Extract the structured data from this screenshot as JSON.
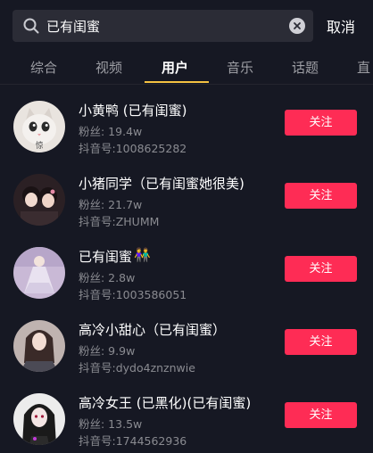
{
  "search": {
    "value": "已有闺蜜",
    "cancel_label": "取消"
  },
  "tabs": [
    {
      "label": "综合"
    },
    {
      "label": "视频"
    },
    {
      "label": "用户"
    },
    {
      "label": "音乐"
    },
    {
      "label": "话题"
    },
    {
      "label": "直"
    }
  ],
  "active_tab": "用户",
  "accent_colors": {
    "follow": "#fe2c55",
    "tab_underline": "#f5c242",
    "background": "#161823"
  },
  "users": [
    {
      "name": "小黄鸭 (已有闺蜜)",
      "fans": "粉丝: 19.4w",
      "id": "抖音号:1008625282",
      "follow_label": "关注",
      "avatar_caption": "惊"
    },
    {
      "name": "小猪同学（已有闺蜜她很美)",
      "fans": "粉丝: 21.7w",
      "id": "抖音号:ZHUMM",
      "follow_label": "关注"
    },
    {
      "name": "已有闺蜜",
      "fans": "粉丝: 2.8w",
      "id": "抖音号:1003586051",
      "follow_label": "关注"
    },
    {
      "name": "高冷小甜心（已有闺蜜）",
      "fans": "粉丝: 9.9w",
      "id": "抖音号:dydo4znznwie",
      "follow_label": "关注"
    },
    {
      "name": "高冷女王 (已黑化)(已有闺蜜)",
      "fans": "粉丝: 13.5w",
      "id": "抖音号:1744562936",
      "follow_label": "关注"
    }
  ]
}
